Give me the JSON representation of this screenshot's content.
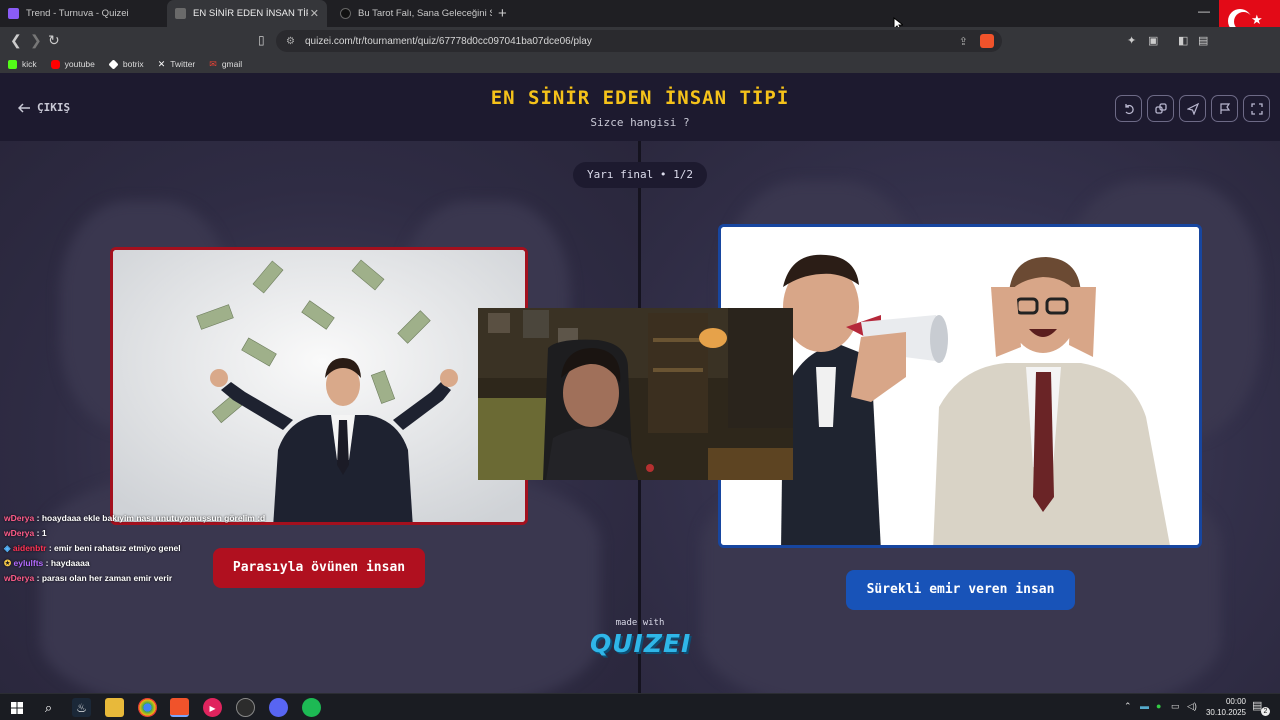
{
  "browser": {
    "tabs": [
      {
        "title": "Trend - Turnuva - Quizei",
        "active": false,
        "favicon_color": "#8a5cf6"
      },
      {
        "title": "EN SİNİR EDEN İNSAN TİPİ - Qu",
        "active": true,
        "favicon_color": "#6a6a6a"
      },
      {
        "title": "Bu Tarot Falı, Sana Geleceğini Söylüyo",
        "active": false,
        "favicon_color": "#111111"
      }
    ],
    "close_tab_glyph": "✕",
    "new_tab_glyph": "+",
    "url": "quizei.com/tr/tournament/quiz/67778d0cc097041ba07dce06/play",
    "bookmarks": [
      {
        "label": "kick",
        "icon_color": "#53fc18"
      },
      {
        "label": "youtube",
        "icon_color": "#ff0000"
      },
      {
        "label": "botrix",
        "icon_color": "#ffffff"
      },
      {
        "label": "Twitter",
        "icon_color": "#000000"
      },
      {
        "label": "gmail",
        "icon_color": "#ea4335"
      }
    ]
  },
  "quiz": {
    "exit_label": "ÇIKIŞ",
    "title": "EN SİNİR EDEN İNSAN TİPİ",
    "subtitle": "Sizce hangisi ?",
    "round_label": "Yarı final • 1/2",
    "left_option": {
      "label": "Parasıyla övünen insan",
      "accent": "#b0101f"
    },
    "right_option": {
      "label": "Sürekli emir veren insan",
      "accent": "#1853b8"
    },
    "made_with": "made with",
    "brand": "QUIZEI",
    "header_buttons": [
      "undo-icon",
      "copy-icon",
      "send-icon",
      "flag-icon",
      "fullscreen-icon"
    ],
    "title_color": "#f5c21a"
  },
  "chat": [
    {
      "user": "wDerya",
      "user_color": "#ff5c8a",
      "text": ": hoaydaaa ekle bakıyim nası unutuyomuşsun görelim :d"
    },
    {
      "user": "wDerya",
      "user_color": "#ff5c8a",
      "text": ": 1"
    },
    {
      "user": "aidenbtr",
      "user_color": "#ff3355",
      "text": ": emir beni rahatsız etmiyo genel"
    },
    {
      "user": "eylulfts",
      "user_color": "#b36bff",
      "text": ": haydaaaa"
    },
    {
      "user": "wDerya",
      "user_color": "#ff5c8a",
      "text": ": parası olan her zaman emir verir"
    }
  ],
  "taskbar": {
    "time": "00:00",
    "date": "30.10.2025",
    "notification_count": "2"
  }
}
